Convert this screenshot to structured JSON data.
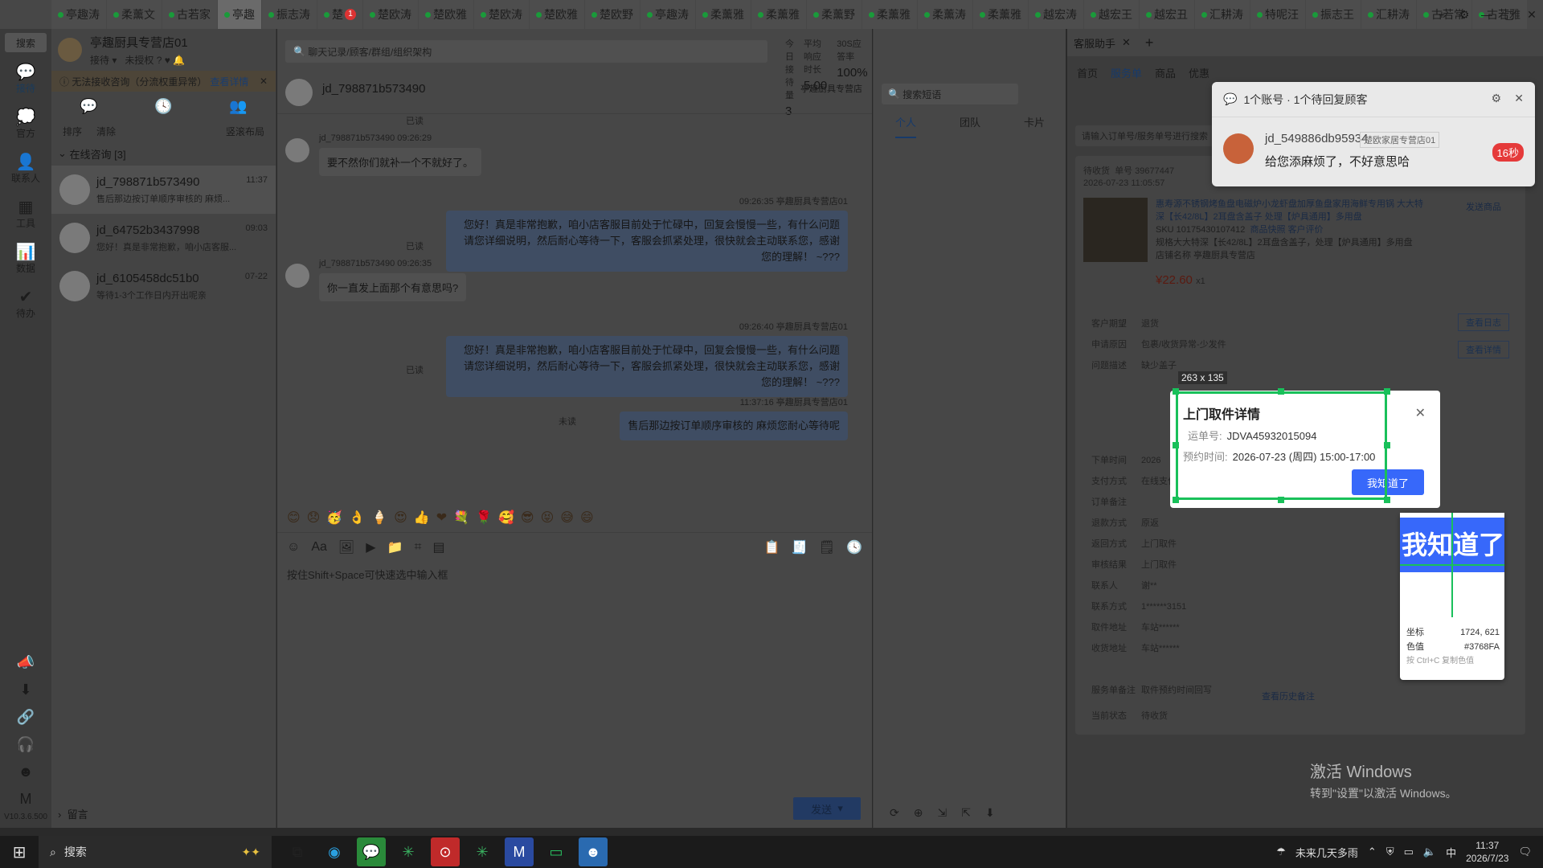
{
  "tabs": [
    "亭趣涛",
    "柔薰文",
    "古若家",
    "亭趣",
    "振志涛",
    "楚",
    "楚欧涛",
    "楚欧雅",
    "楚欧涛",
    "楚欧雅",
    "楚欧野",
    "亭趣涛",
    "柔薰雅",
    "柔薰雅",
    "柔薰野",
    "柔薰雅",
    "柔薰涛",
    "柔薰雅",
    "越宏涛",
    "越宏王",
    "越宏丑",
    "汇耕涛",
    "特呢汪",
    "振志王",
    "汇耕涛",
    "古若常",
    "古若雅"
  ],
  "tab_badge": "1",
  "window_controls": {
    "gear": "⚙",
    "min": "—",
    "max": "▢",
    "close": "✕",
    "plus": "+"
  },
  "leftnav": {
    "search": "搜索",
    "items": [
      {
        "icon": "💬",
        "label": "接待"
      },
      {
        "icon": "💭",
        "label": "官方"
      },
      {
        "icon": "👤",
        "label": "联系人"
      },
      {
        "icon": "▦",
        "label": "工具"
      },
      {
        "icon": "📊",
        "label": "数据"
      },
      {
        "icon": "✔",
        "label": "待办"
      }
    ],
    "bottom_icons": [
      "📣",
      "⬇",
      "🔗",
      "🎧",
      "☻",
      "M"
    ],
    "version": "V10.3.6.500"
  },
  "shop": {
    "name": "亭趣厨具专营店01",
    "status": "接待",
    "auth": "未授权",
    "help": "?"
  },
  "warning": {
    "text": "无法接收咨询（分流权重异常）",
    "link": "查看详情",
    "close": "✕"
  },
  "list_tools": {
    "sort": "排序",
    "clear": "清除",
    "layout": "竖滚布局"
  },
  "group": {
    "label": "在线咨询 [3]"
  },
  "conversations": [
    {
      "name": "jd_798871b573490",
      "time": "11:37",
      "preview": "售后那边按订单顺序审核的 麻烦..."
    },
    {
      "name": "jd_64752b3437998",
      "time": "09:03",
      "preview": "您好！真是非常抱歉，咱小店客服..."
    },
    {
      "name": "jd_6105458dc51b0",
      "time": "07-22",
      "preview": "等待1-3个工作日内开出呢亲"
    }
  ],
  "leave_msg": "留言",
  "chat": {
    "search_placeholder": "聊天记录/顾客/群组/组织架构",
    "stats": [
      {
        "label": "今日接待量",
        "value": "3"
      },
      {
        "label": "平均响应时长",
        "value": "5.00"
      },
      {
        "label": "30S应答率",
        "value": "100%"
      },
      {
        "label": "今日促成下单金额",
        "value": "0.00"
      }
    ],
    "customer": "jd_798871b573490",
    "shop": "亭趣厨具专营店",
    "messages": [
      {
        "dir": "in",
        "meta": "jd_798871b573490 09:26:29",
        "text": "要不然你们就补一个不就好了。"
      },
      {
        "dir": "out",
        "meta": "09:26:35 亭趣厨具专营店01",
        "text": "您好！真是非常抱歉，咱小店客服目前处于忙碌中，回复会慢慢一些，有什么问题请您详细说明，然后耐心等待一下，客服会抓紧处理，很快就会主动联系您，感谢您的理解！ ~???",
        "read": "已读"
      },
      {
        "dir": "in",
        "meta": "jd_798871b573490 09:26:35",
        "text": "你一直发上面那个有意思吗?"
      },
      {
        "dir": "out",
        "meta": "09:26:40 亭趣厨具专营店01",
        "text": "您好！真是非常抱歉，咱小店客服目前处于忙碌中，回复会慢慢一些，有什么问题请您详细说明，然后耐心等待一下，客服会抓紧处理，很快就会主动联系您，感谢您的理解！ ~???",
        "read": "已读"
      },
      {
        "dir": "out",
        "meta": "11:37:16 亭趣厨具专营店01",
        "text": "售后那边按订单顺序审核的 麻烦您耐心等待呢",
        "read": "未读"
      }
    ],
    "top_read": "已读",
    "emojis": "😊😞🥳👌🍦😍👍❤💐🌹🥰😎😝😅😄",
    "input_placeholder": "按住Shift+Space可快速选中输入框",
    "send": "发送"
  },
  "quick": {
    "search": "搜索短语",
    "tabs": [
      "个人",
      "团队",
      "卡片"
    ]
  },
  "service": {
    "tab": "客服助手",
    "nav": [
      "首页",
      "服务单",
      "商品",
      "优惠"
    ],
    "search_placeholder": "请输入订单号/服务单号进行搜索",
    "order_tag": "待收货",
    "order_no": "单号 39677447",
    "order_time": "2026-07-23 11:05:57",
    "product_title": "惠寿源不锈钢烤鱼盘电磁炉小龙虾盘加厚鱼盘家用海鲜专用锅 大大特深【长42/8L】2耳盘含盖子 处理【炉具通用】多用盘",
    "sku": "SKU 10175430107412",
    "sku_links": "商品快照  客户评价",
    "spec": "规格大大特深【长42/8L】2耳盘含盖子，处理【炉具通用】多用盘",
    "store": "店铺名称 亭趣厨具专营店",
    "price": "¥22.60",
    "qty": "x1",
    "send_product": "发送商品",
    "rows": [
      {
        "k": "客户期望",
        "v": "退货"
      },
      {
        "k": "申请原因",
        "v": "包裹/收货异常-少发件"
      },
      {
        "k": "问题描述",
        "v": "缺少盖子"
      },
      {
        "k": "下单时间",
        "v": "2026"
      },
      {
        "k": "支付方式",
        "v": "在线支付"
      },
      {
        "k": "订单备注",
        "v": ""
      },
      {
        "k": "退款方式",
        "v": "原返"
      },
      {
        "k": "返回方式",
        "v": "上门取件"
      },
      {
        "k": "审核结果",
        "v": "上门取件"
      },
      {
        "k": "联系人",
        "v": "谢**"
      },
      {
        "k": "联系方式",
        "v": "1******3151"
      },
      {
        "k": "取件地址",
        "v": "车站******"
      },
      {
        "k": "收货地址",
        "v": "车站******"
      },
      {
        "k": "服务单备注",
        "v": "取件预约时间回写"
      },
      {
        "k": "当前状态",
        "v": "待收货"
      }
    ],
    "history_link": "查看历史备注",
    "btn_log": "查看日志",
    "btn_detail": "查看详情"
  },
  "notice": {
    "title": "1个账号 · 1个待回复顾客",
    "user": "jd_549886db95934",
    "shop": "楚欧家居专营店01",
    "message": "给您添麻烦了，不好意思哈",
    "timer": "16秒",
    "badge": "1"
  },
  "modal": {
    "title": "上门取件详情",
    "waybill_label": "运单号:",
    "waybill": "JDVA45932015094",
    "time_label": "预约时间:",
    "time": "2026-07-23 (周四) 15:00-17:00",
    "ok": "我知道了",
    "close": "✕"
  },
  "capture": {
    "size": "263 x 135",
    "zoom_text": "我知道了",
    "coord_label": "坐标",
    "coord": "1724, 621",
    "color_label": "色值",
    "color": "#3768FA",
    "hint": "按 Ctrl+C 复制色值"
  },
  "activate": {
    "line1": "激活 Windows",
    "line2": "转到\"设置\"以激活 Windows。"
  },
  "taskbar": {
    "search": "搜索",
    "weather": "未来几天多雨",
    "ime": "中",
    "time": "11:37",
    "date": "2026/7/23"
  }
}
